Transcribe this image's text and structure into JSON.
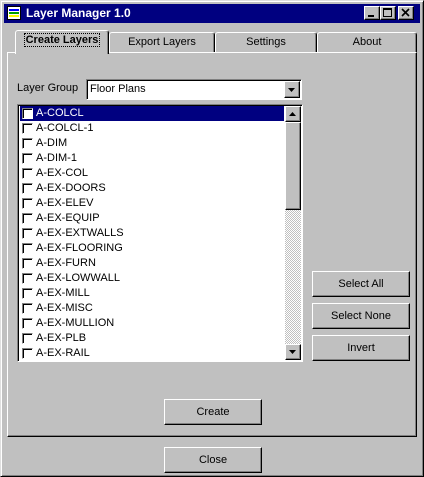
{
  "window": {
    "title": "Layer Manager 1.0"
  },
  "tabs": [
    {
      "label": "Create Layers",
      "active": true
    },
    {
      "label": "Export Layers",
      "active": false
    },
    {
      "label": "Settings",
      "active": false
    },
    {
      "label": "About",
      "active": false
    }
  ],
  "layer_group": {
    "label": "Layer Group",
    "value": "Floor Plans"
  },
  "layers": [
    "A-COLCL",
    "A-COLCL-1",
    "A-DIM",
    "A-DIM-1",
    "A-EX-COL",
    "A-EX-DOORS",
    "A-EX-ELEV",
    "A-EX-EQUIP",
    "A-EX-EXTWALLS",
    "A-EX-FLOORING",
    "A-EX-FURN",
    "A-EX-LOWWALL",
    "A-EX-MILL",
    "A-EX-MISC",
    "A-EX-MULLION",
    "A-EX-PLB",
    "A-EX-RAIL"
  ],
  "selected_index": 0,
  "buttons": {
    "select_all": "Select All",
    "select_none": "Select None",
    "invert": "Invert",
    "create": "Create",
    "close": "Close"
  },
  "icons": [
    "app-icon",
    "minimize-icon",
    "maximize-icon",
    "close-icon",
    "dropdown-arrow-icon",
    "scroll-up-icon",
    "scroll-down-icon"
  ],
  "colors": {
    "titlebar": "#000080",
    "face": "#c0c0c0",
    "selection": "#000080"
  }
}
